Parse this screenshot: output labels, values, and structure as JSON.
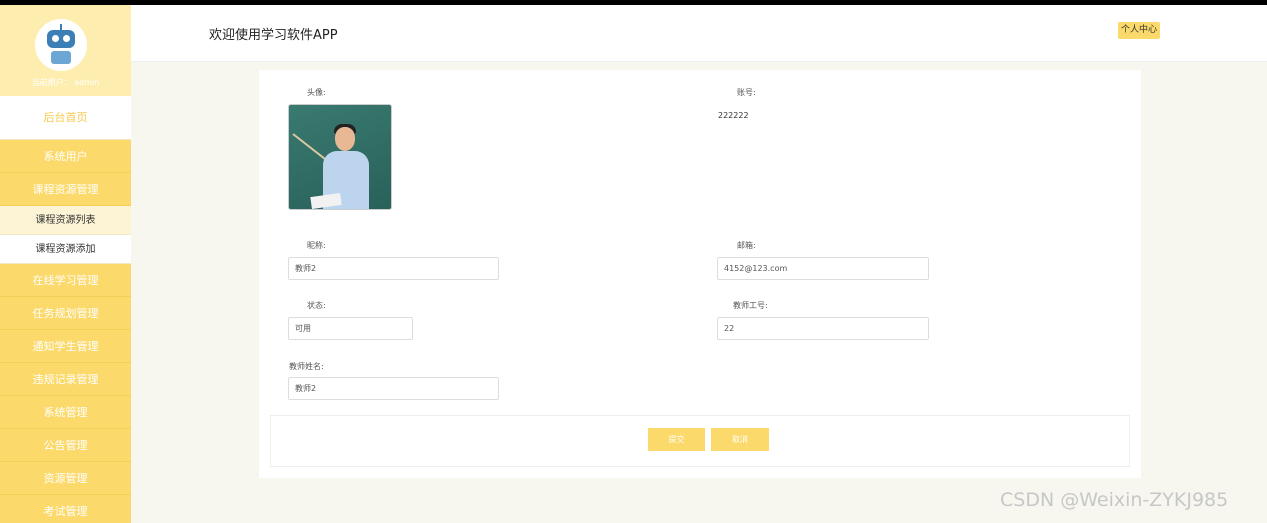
{
  "sidebar": {
    "current_user": "当前用户： admin",
    "home": "后台首页",
    "items": [
      "系统用户",
      "课程资源管理"
    ],
    "sub_items": [
      "课程资源列表",
      "课程资源添加"
    ],
    "items_after": [
      "在线学习管理",
      "任务规划管理",
      "通知学生管理",
      "违规记录管理",
      "系统管理",
      "公告管理",
      "资源管理",
      "考试管理"
    ]
  },
  "header": {
    "welcome": "欢迎使用学习软件APP",
    "personal_center": "个人中心"
  },
  "form": {
    "avatar_label": "头像:",
    "account_label": "账号:",
    "account_value": "222222",
    "nickname_label": "昵称:",
    "nickname_value": "教师2",
    "email_label": "邮箱:",
    "email_value": "4152@123.com",
    "status_label": "状态:",
    "status_value": "可用",
    "teacher_no_label": "教师工号:",
    "teacher_no_value": "22",
    "teacher_name_label": "教师姓名:",
    "teacher_name_value": "教师2",
    "submit_label": "提交",
    "cancel_label": "取消"
  },
  "watermark": "CSDN @Weixin-ZYKJ985"
}
